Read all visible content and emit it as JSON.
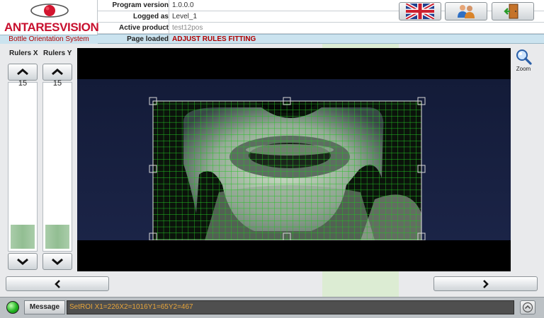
{
  "app": {
    "brand": "ANTARESVISION",
    "subtitle": "Bottle Orientation System"
  },
  "info": {
    "program_version_label": "Program version",
    "program_version": "1.0.0.0",
    "logged_as_label": "Logged as",
    "logged_as": "Level_1",
    "active_product_label": "Active product",
    "active_product": "test12pos",
    "page_loaded_label": "Page loaded",
    "page_loaded": "ADJUST RULES FITTING"
  },
  "header_buttons": {
    "language": "uk-flag-icon",
    "users": "users-icon",
    "exit": "exit-door-icon"
  },
  "rulers": {
    "x_label": "Rulers X",
    "y_label": "Rulers Y",
    "x_value": "15",
    "y_value": "15"
  },
  "zoom": {
    "label": "Zoom"
  },
  "footer": {
    "message_label": "Message",
    "message_text": "SetROI X1=226X2=1016Y1=65Y2=467"
  },
  "colors": {
    "brand_red": "#c8102e",
    "loaded_bg": "#cbe3ef",
    "grid_green": "#22c222",
    "message_text": "#e8a53a",
    "status_green": "#21b421"
  }
}
